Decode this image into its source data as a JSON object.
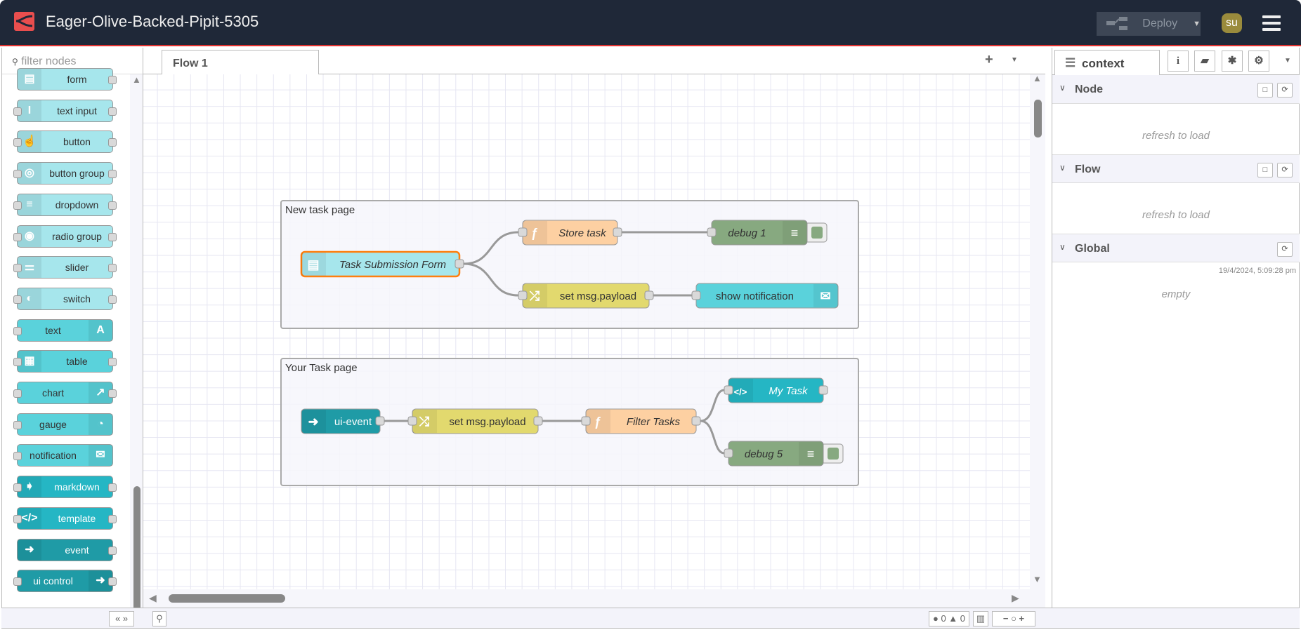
{
  "header": {
    "title": "Eager-Olive-Backed-Pipit-5305",
    "deploy_label": "Deploy",
    "user_initials": "su"
  },
  "palette": {
    "filter_placeholder": "filter nodes",
    "nodes": [
      {
        "label": "form",
        "icon": "form-icon"
      },
      {
        "label": "text input",
        "icon": "text-cursor-icon"
      },
      {
        "label": "button",
        "icon": "hand-pointer-icon"
      },
      {
        "label": "button group",
        "icon": "toggle-group-icon"
      },
      {
        "label": "dropdown",
        "icon": "list-icon"
      },
      {
        "label": "radio group",
        "icon": "radio-icon"
      },
      {
        "label": "slider",
        "icon": "sliders-icon"
      },
      {
        "label": "switch",
        "icon": "toggle-icon"
      },
      {
        "label": "text",
        "icon": "font-icon"
      },
      {
        "label": "table",
        "icon": "table-icon"
      },
      {
        "label": "chart",
        "icon": "line-chart-icon"
      },
      {
        "label": "gauge",
        "icon": "gauge-icon"
      },
      {
        "label": "notification",
        "icon": "envelope-icon"
      },
      {
        "label": "markdown",
        "icon": "markdown-icon"
      },
      {
        "label": "template",
        "icon": "code-icon"
      },
      {
        "label": "event",
        "icon": "arrow-circle-icon"
      },
      {
        "label": "ui control",
        "icon": "arrow-circle-icon"
      }
    ]
  },
  "workspace": {
    "tab": "Flow 1",
    "groups": [
      {
        "label": "New task page"
      },
      {
        "label": "Your Task page"
      }
    ],
    "nodes": {
      "form": "Task Submission Form",
      "store": "Store task",
      "debug1": "debug 1",
      "set1": "set msg.payload",
      "notif": "show notification",
      "event": "ui-event",
      "set2": "set msg.payload",
      "filter": "Filter Tasks",
      "mytask": "My Task",
      "debug5": "debug 5"
    },
    "colors": {
      "ui_light": "#a6e6ec",
      "ui_mid": "#5ad2db",
      "ui_dark": "#25b6c4",
      "ui_darkest": "#1f9ba6",
      "function": "#fdd0a2",
      "change": "#e2d96e",
      "debug": "#87a980",
      "selected": "#ff7f0e",
      "wire": "#999999"
    },
    "footer": {
      "errors": "0",
      "warnings": "0"
    }
  },
  "sidebar": {
    "tab": "context",
    "sections": [
      {
        "title": "Node",
        "message": "refresh to load"
      },
      {
        "title": "Flow",
        "message": "refresh to load"
      },
      {
        "title": "Global",
        "timestamp": "19/4/2024, 5:09:28 pm",
        "message": "empty"
      }
    ]
  }
}
